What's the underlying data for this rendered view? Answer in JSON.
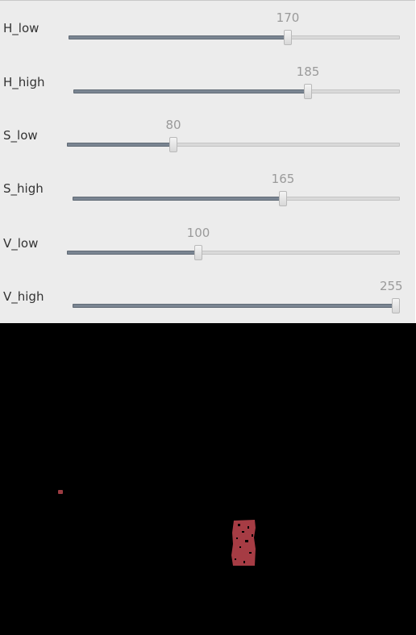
{
  "sliders": [
    {
      "label": "H_low",
      "value": "170",
      "level": 0.667
    },
    {
      "label": "H_high",
      "value": "185",
      "level": 0.725
    },
    {
      "label": "S_low",
      "value": "80",
      "level": 0.314
    },
    {
      "label": "S_high",
      "value": "165",
      "level": 0.647
    },
    {
      "label": "V_low",
      "value": "100",
      "level": 0.392
    },
    {
      "label": "V_high",
      "value": "255",
      "level": 1.0
    }
  ],
  "colors": {
    "panel_bg": "#ececec",
    "track": "#d9d9d9",
    "fill": "#7a8592",
    "value_text": "#9a9a9a",
    "mask_bg": "#000000",
    "blob": "#a63c44"
  }
}
